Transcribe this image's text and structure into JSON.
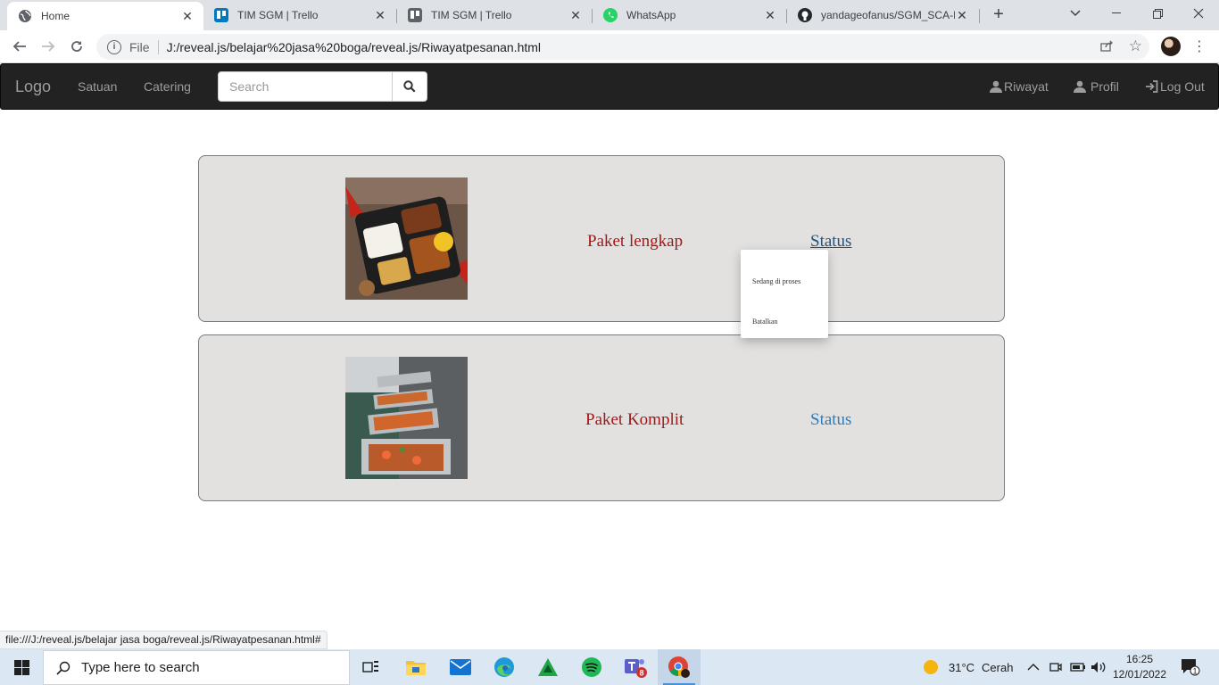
{
  "browser": {
    "tabs": [
      {
        "title": "Home",
        "active": true
      },
      {
        "title": "TIM SGM | Trello",
        "active": false
      },
      {
        "title": "TIM SGM | Trello",
        "active": false
      },
      {
        "title": "WhatsApp",
        "active": false
      },
      {
        "title": "yandageofanus/SGM_SCA-Pa",
        "active": false
      }
    ],
    "new_tab": "+",
    "address": {
      "scheme_label": "File",
      "url": "J:/reveal.js/belajar%20jasa%20boga/reveal.js/Riwayatpesanan.html"
    },
    "status_url": "file:///J:/reveal.js/belajar jasa boga/reveal.js/Riwayatpesanan.html#"
  },
  "navbar": {
    "brand": "Logo",
    "links": [
      "Satuan",
      "Catering"
    ],
    "search_placeholder": "Search",
    "right_links": [
      "Riwayat",
      "Profil",
      "Log Out"
    ]
  },
  "orders": [
    {
      "name": "Paket lengkap",
      "status_label": "Status",
      "image": "lunch-box-photo"
    },
    {
      "name": "Paket Komplit",
      "status_label": "Status",
      "image": "catering-buffet-photo"
    }
  ],
  "status_menu": {
    "items": [
      "Sedang di proses",
      "Batalkan"
    ]
  },
  "taskbar": {
    "search_placeholder": "Type here to search",
    "teams_badge": "8",
    "weather": {
      "temp": "31°C",
      "condition": "Cerah"
    },
    "time": "16:25",
    "date": "12/01/2022",
    "notification_count": "1"
  },
  "colors": {
    "navbar_bg": "#222222",
    "card_bg": "#e3e1e0",
    "package_text": "#a01919",
    "link_blue": "#337ab7"
  }
}
